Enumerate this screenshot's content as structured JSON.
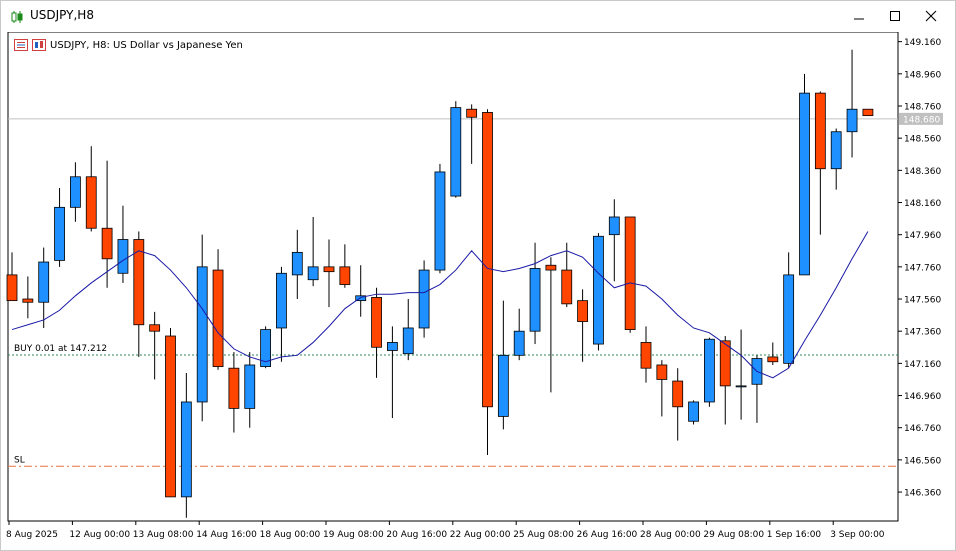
{
  "window": {
    "title": "USDJPY,H8",
    "minimize_icon": "minimize-icon",
    "maximize_icon": "maximize-icon",
    "close_icon": "close-icon"
  },
  "chart": {
    "header_text": "USDJPY, H8:  US Dollar vs Japanese Yen",
    "current_price_label": "148.680",
    "buy_label": "BUY 0.01 at 147.212",
    "sl_label": "SL",
    "colors": {
      "bull": "#1e90ff",
      "bear": "#ff4500",
      "ma": "#1a1aa6",
      "buy_line": "#2e8b57",
      "sl_line": "#e8743b",
      "price_line": "#c0c0c0",
      "price_tag": "#c0c0c0"
    }
  },
  "chart_data": {
    "type": "candlestick",
    "symbol": "USDJPY",
    "timeframe": "H8",
    "y_ticks": [
      "149.160",
      "148.960",
      "148.760",
      "148.560",
      "148.360",
      "148.160",
      "147.960",
      "147.760",
      "147.560",
      "147.360",
      "147.160",
      "146.960",
      "146.760",
      "146.560",
      "146.360"
    ],
    "x_ticks": [
      "8 Aug 2025",
      "12 Aug 00:00",
      "13 Aug 08:00",
      "14 Aug 16:00",
      "18 Aug 00:00",
      "19 Aug 08:00",
      "20 Aug 16:00",
      "22 Aug 00:00",
      "25 Aug 08:00",
      "26 Aug 16:00",
      "28 Aug 00:00",
      "29 Aug 08:00",
      "1 Sep 16:00",
      "3 Sep 00:00"
    ],
    "ylim": [
      146.18,
      149.22
    ],
    "candles": [
      {
        "o": 147.71,
        "h": 147.85,
        "l": 147.55,
        "c": 147.55
      },
      {
        "o": 147.56,
        "h": 147.7,
        "l": 147.44,
        "c": 147.54
      },
      {
        "o": 147.54,
        "h": 147.88,
        "l": 147.38,
        "c": 147.79
      },
      {
        "o": 147.8,
        "h": 148.25,
        "l": 147.76,
        "c": 148.13
      },
      {
        "o": 148.13,
        "h": 148.41,
        "l": 148.04,
        "c": 148.32
      },
      {
        "o": 148.32,
        "h": 148.51,
        "l": 147.98,
        "c": 148.0
      },
      {
        "o": 148.0,
        "h": 148.42,
        "l": 147.63,
        "c": 147.81
      },
      {
        "o": 147.72,
        "h": 148.14,
        "l": 147.66,
        "c": 147.93
      },
      {
        "o": 147.93,
        "h": 147.98,
        "l": 147.2,
        "c": 147.4
      },
      {
        "o": 147.4,
        "h": 147.48,
        "l": 147.06,
        "c": 147.36
      },
      {
        "o": 147.33,
        "h": 147.38,
        "l": 146.33,
        "c": 146.33
      },
      {
        "o": 146.33,
        "h": 147.1,
        "l": 146.2,
        "c": 146.92
      },
      {
        "o": 146.92,
        "h": 147.96,
        "l": 146.8,
        "c": 147.76
      },
      {
        "o": 147.74,
        "h": 147.87,
        "l": 147.12,
        "c": 147.14
      },
      {
        "o": 147.13,
        "h": 147.23,
        "l": 146.73,
        "c": 146.88
      },
      {
        "o": 146.88,
        "h": 147.23,
        "l": 146.76,
        "c": 147.15
      },
      {
        "o": 147.14,
        "h": 147.39,
        "l": 147.13,
        "c": 147.37
      },
      {
        "o": 147.38,
        "h": 147.76,
        "l": 147.17,
        "c": 147.72
      },
      {
        "o": 147.71,
        "h": 147.99,
        "l": 147.56,
        "c": 147.85
      },
      {
        "o": 147.68,
        "h": 148.07,
        "l": 147.64,
        "c": 147.76
      },
      {
        "o": 147.76,
        "h": 147.93,
        "l": 147.51,
        "c": 147.73
      },
      {
        "o": 147.76,
        "h": 147.9,
        "l": 147.63,
        "c": 147.65
      },
      {
        "o": 147.55,
        "h": 147.77,
        "l": 147.45,
        "c": 147.58
      },
      {
        "o": 147.57,
        "h": 147.63,
        "l": 147.07,
        "c": 147.26
      },
      {
        "o": 147.24,
        "h": 147.39,
        "l": 146.82,
        "c": 147.29
      },
      {
        "o": 147.22,
        "h": 147.56,
        "l": 147.18,
        "c": 147.38
      },
      {
        "o": 147.38,
        "h": 147.8,
        "l": 147.32,
        "c": 147.74
      },
      {
        "o": 147.74,
        "h": 148.4,
        "l": 147.72,
        "c": 148.35
      },
      {
        "o": 148.2,
        "h": 148.79,
        "l": 148.19,
        "c": 148.75
      },
      {
        "o": 148.74,
        "h": 148.77,
        "l": 148.4,
        "c": 148.69
      },
      {
        "o": 148.72,
        "h": 148.74,
        "l": 146.59,
        "c": 146.89
      },
      {
        "o": 146.83,
        "h": 147.55,
        "l": 146.75,
        "c": 147.21
      },
      {
        "o": 147.21,
        "h": 147.5,
        "l": 147.18,
        "c": 147.36
      },
      {
        "o": 147.36,
        "h": 147.91,
        "l": 147.28,
        "c": 147.75
      },
      {
        "o": 147.77,
        "h": 147.82,
        "l": 146.98,
        "c": 147.74
      },
      {
        "o": 147.74,
        "h": 147.91,
        "l": 147.51,
        "c": 147.53
      },
      {
        "o": 147.55,
        "h": 147.62,
        "l": 147.17,
        "c": 147.42
      },
      {
        "o": 147.28,
        "h": 147.97,
        "l": 147.24,
        "c": 147.95
      },
      {
        "o": 147.96,
        "h": 148.18,
        "l": 147.67,
        "c": 148.07
      },
      {
        "o": 148.07,
        "h": 148.07,
        "l": 147.35,
        "c": 147.37
      },
      {
        "o": 147.29,
        "h": 147.39,
        "l": 147.04,
        "c": 147.13
      },
      {
        "o": 147.15,
        "h": 147.18,
        "l": 146.83,
        "c": 147.06
      },
      {
        "o": 147.05,
        "h": 147.13,
        "l": 146.68,
        "c": 146.89
      },
      {
        "o": 146.8,
        "h": 146.93,
        "l": 146.78,
        "c": 146.92
      },
      {
        "o": 146.92,
        "h": 147.32,
        "l": 146.89,
        "c": 147.31
      },
      {
        "o": 147.3,
        "h": 147.33,
        "l": 146.78,
        "c": 147.02
      },
      {
        "o": 147.02,
        "h": 147.37,
        "l": 146.81,
        "c": 147.02
      },
      {
        "o": 147.03,
        "h": 147.21,
        "l": 146.79,
        "c": 147.19
      },
      {
        "o": 147.2,
        "h": 147.29,
        "l": 147.15,
        "c": 147.17
      },
      {
        "o": 147.16,
        "h": 147.85,
        "l": 147.13,
        "c": 147.71
      },
      {
        "o": 147.71,
        "h": 148.96,
        "l": 147.71,
        "c": 148.84
      },
      {
        "o": 148.84,
        "h": 148.85,
        "l": 147.96,
        "c": 148.37
      },
      {
        "o": 148.37,
        "h": 148.62,
        "l": 148.24,
        "c": 148.6
      },
      {
        "o": 148.6,
        "h": 149.11,
        "l": 148.44,
        "c": 148.74
      },
      {
        "o": 148.74,
        "h": 148.74,
        "l": 148.7,
        "c": 148.7
      }
    ],
    "moving_average": [
      147.37,
      147.4,
      147.43,
      147.49,
      147.58,
      147.66,
      147.73,
      147.8,
      147.86,
      147.83,
      147.74,
      147.63,
      147.5,
      147.35,
      147.25,
      147.2,
      147.17,
      147.2,
      147.21,
      147.29,
      147.39,
      147.5,
      147.57,
      147.59,
      147.59,
      147.6,
      147.6,
      147.65,
      147.74,
      147.86,
      147.75,
      147.73,
      147.75,
      147.78,
      147.83,
      147.86,
      147.82,
      147.72,
      147.63,
      147.66,
      147.64,
      147.56,
      147.46,
      147.38,
      147.35,
      147.28,
      147.21,
      147.11,
      147.07,
      147.13,
      147.3,
      147.46,
      147.63,
      147.81,
      147.98
    ],
    "current_price": 148.68,
    "buy_level": 147.212,
    "sl_level": 146.52
  }
}
